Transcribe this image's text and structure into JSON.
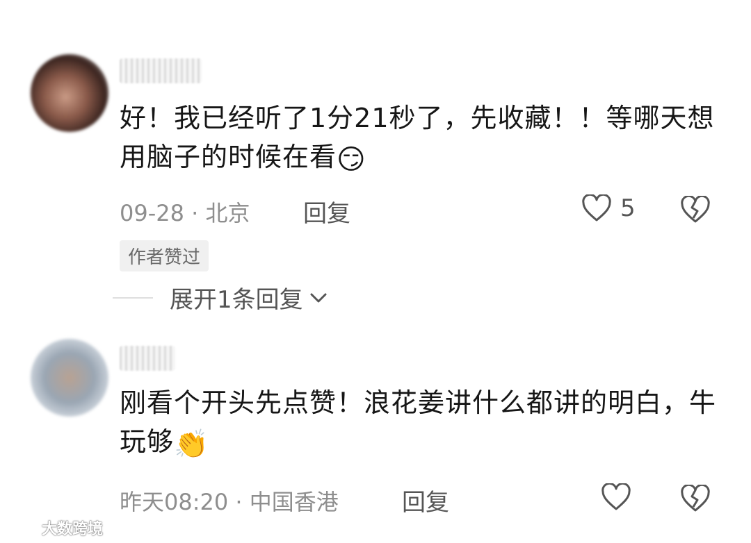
{
  "comments": [
    {
      "text": "好！我已经听了1分21秒了，先收藏！！等哪天想用脑子的时候在看",
      "emoji": "😏",
      "meta": "09-28 · 北京",
      "reply_label": "回复",
      "like_count": "5",
      "badge": "作者赞过",
      "expand_label": "展开1条回复"
    },
    {
      "text": "刚看个开头先点赞！浪花姜讲什么都讲的明白，牛 玩够",
      "emoji": "👏",
      "meta": "昨天08:20 · 中国香港",
      "reply_label": "回复",
      "like_count": ""
    }
  ],
  "watermark": "大数跨境",
  "icons": {
    "like": "heart-outline-icon",
    "dislike": "broken-heart-icon",
    "expand": "chevron-down-icon"
  }
}
